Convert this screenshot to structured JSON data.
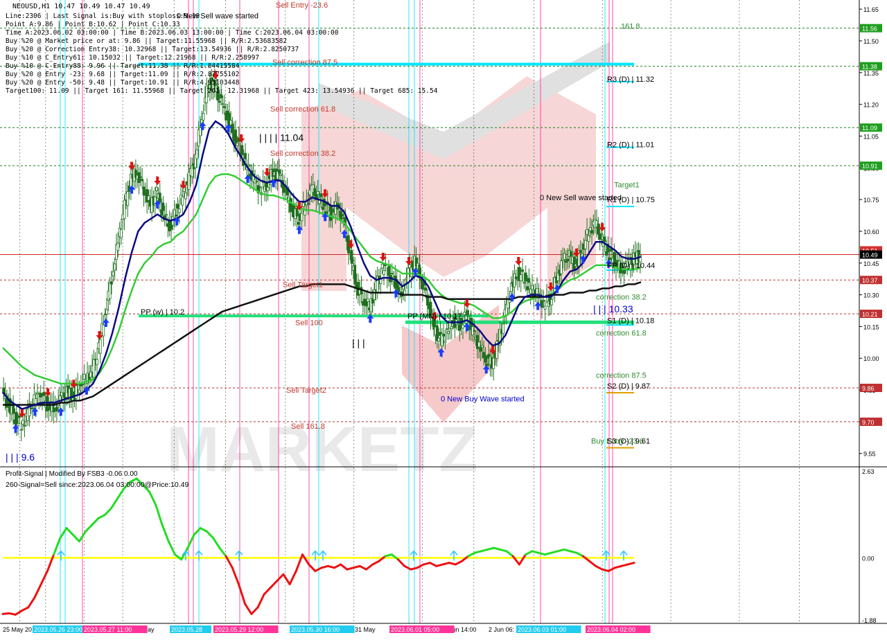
{
  "header": {
    "symbol_line": "NEOUSD,H1  10.47 10.49 10.47 10.49",
    "lines": [
      "Line:2306 | Last Signal is:Buy with stoploss:9.19",
      "Point A:9.86 | Point B:10.62 | Point C:10.33",
      "Time A:2023.06.02 03:00:00 | Time B:2023.06.03 13:00:00 | Time C:2023.06.04 03:00:00",
      "Buy %20 @ Market price or at: 9.86 || Target:11.55968 || R/R:2.53683582",
      "Buy %20 @ Correction Entry38: 10.32968 || Target:13.54936 || R/R:2.8250737",
      "Buy %10 @ C_Entry61: 10.15032 || Target:12.21968 || R/R:2.258997",
      "Buy %10 @ C_Entry88: 9.96 || Target:11.38 || R/R:1.84415584",
      "Buy %20 @ Entry -23: 9.68 || Target:11.09 || R/R:2.87755102",
      "Buy %20 @ Entry -50: 9.48 || Target:10.91 || R/R:4.93103448",
      "Target100: 11.09 || Target 161: 11.55968 || Target 261: 12.31968 || Target 423: 13.54936 || Target 685: 15.54"
    ]
  },
  "chart_data": {
    "type": "line",
    "title": "NEOUSD,H1",
    "ylim": [
      9.5,
      11.68
    ],
    "y_ticks": [
      9.55,
      9.7,
      9.85,
      10.0,
      10.15,
      10.3,
      10.45,
      10.6,
      10.75,
      10.9,
      11.05,
      11.2,
      11.35,
      11.5,
      11.65
    ],
    "x_ticks": [
      "25 May 20",
      "27 May",
      "31 May",
      "Jun 14:00",
      "2 Jun 06:",
      "06:00"
    ],
    "x_highlight_labels": [
      "2023.05.26 23:00",
      "2023.05.27 11:00",
      "2023.05.28",
      "2023.05.29 12:00",
      "2023.05.30 16:00",
      "2023.06.01 05:00",
      "2023.06.03 01:00",
      "2023.06.04 02:00"
    ],
    "price_line": 10.49,
    "price_tags": [
      {
        "value": "11.56",
        "price": 11.56,
        "color": "#1f9f1f"
      },
      {
        "value": "11.38",
        "price": 11.38,
        "color": "#1f9f1f"
      },
      {
        "value": "11.09",
        "price": 11.09,
        "color": "#1f9f1f"
      },
      {
        "value": "10.91",
        "price": 10.91,
        "color": "#1f9f1f"
      },
      {
        "value": "10.51",
        "price": 10.51,
        "color": "#d03030"
      },
      {
        "value": "10.49",
        "price": 10.49,
        "color": "#000000"
      },
      {
        "value": "10.37",
        "price": 10.37,
        "color": "#c03030"
      },
      {
        "value": "10.21",
        "price": 10.21,
        "color": "#c03030"
      },
      {
        "value": "9.86",
        "price": 9.86,
        "color": "#c03030"
      },
      {
        "value": "9.70",
        "price": 9.7,
        "color": "#c03030"
      }
    ],
    "hlines": [
      {
        "price": 11.56,
        "color": "#1f7f1f",
        "style": "dashed"
      },
      {
        "price": 11.38,
        "color": "#1f7f1f",
        "style": "dashed"
      },
      {
        "price": 11.09,
        "color": "#1f7f1f",
        "style": "dashed"
      },
      {
        "price": 10.91,
        "color": "#1f7f1f",
        "style": "dashed"
      },
      {
        "price": 10.37,
        "color": "#b03030",
        "style": "dashed"
      },
      {
        "price": 10.21,
        "color": "#b03030",
        "style": "dashed"
      },
      {
        "price": 9.86,
        "color": "#b03030",
        "style": "dashed"
      },
      {
        "price": 9.7,
        "color": "#b03030",
        "style": "dashed"
      }
    ],
    "close_series": [
      9.84,
      9.78,
      9.72,
      9.68,
      9.74,
      9.8,
      9.82,
      9.78,
      9.76,
      9.8,
      9.84,
      9.82,
      9.88,
      9.9,
      9.94,
      10.05,
      10.22,
      10.38,
      10.55,
      10.72,
      10.85,
      10.88,
      10.8,
      10.72,
      10.78,
      10.68,
      10.62,
      10.7,
      10.76,
      10.85,
      10.95,
      11.15,
      11.3,
      11.28,
      11.2,
      11.14,
      11.05,
      10.98,
      10.9,
      10.84,
      10.8,
      10.82,
      10.88,
      10.86,
      10.78,
      10.7,
      10.66,
      10.72,
      10.8,
      10.76,
      10.72,
      10.68,
      10.72,
      10.64,
      10.48,
      10.34,
      10.28,
      10.24,
      10.34,
      10.42,
      10.4,
      10.36,
      10.3,
      10.4,
      10.46,
      10.38,
      10.28,
      10.14,
      10.08,
      10.12,
      10.18,
      10.16,
      10.2,
      10.12,
      10.06,
      10.0,
      9.98,
      10.08,
      10.2,
      10.34,
      10.4,
      10.38,
      10.32,
      10.3,
      10.26,
      10.28,
      10.38,
      10.46,
      10.48,
      10.44,
      10.52,
      10.6,
      10.64,
      10.56,
      10.5,
      10.46,
      10.42,
      10.44,
      10.47,
      10.49
    ],
    "ma_slow_dark_blue": [
      9.84,
      9.8,
      9.78,
      9.76,
      9.77,
      9.78,
      9.79,
      9.79,
      9.79,
      9.8,
      9.81,
      9.82,
      9.83,
      9.85,
      9.88,
      9.94,
      10.02,
      10.12,
      10.24,
      10.38,
      10.5,
      10.6,
      10.64,
      10.66,
      10.68,
      10.66,
      10.65,
      10.66,
      10.68,
      10.74,
      10.82,
      10.96,
      11.08,
      11.12,
      11.1,
      11.06,
      11.0,
      10.95,
      10.9,
      10.86,
      10.84,
      10.83,
      10.84,
      10.84,
      10.81,
      10.77,
      10.74,
      10.74,
      10.76,
      10.75,
      10.74,
      10.72,
      10.72,
      10.69,
      10.62,
      10.53,
      10.45,
      10.39,
      10.37,
      10.38,
      10.38,
      10.37,
      10.34,
      10.36,
      10.39,
      10.38,
      10.34,
      10.27,
      10.2,
      10.17,
      10.17,
      10.17,
      10.18,
      10.16,
      10.13,
      10.09,
      10.06,
      10.07,
      10.11,
      10.18,
      10.25,
      10.29,
      10.3,
      10.3,
      10.29,
      10.29,
      10.32,
      10.37,
      10.41,
      10.42,
      10.45,
      10.5,
      10.55,
      10.55,
      10.53,
      10.51,
      10.48,
      10.47,
      10.47,
      10.48
    ],
    "ma_mid_green": [
      10.05,
      10.02,
      9.99,
      9.96,
      9.94,
      9.92,
      9.91,
      9.9,
      9.89,
      9.88,
      9.88,
      9.88,
      9.88,
      9.89,
      9.9,
      9.93,
      9.98,
      10.05,
      10.13,
      10.23,
      10.32,
      10.4,
      10.45,
      10.48,
      10.52,
      10.54,
      10.55,
      10.58,
      10.6,
      10.64,
      10.68,
      10.75,
      10.82,
      10.86,
      10.87,
      10.87,
      10.86,
      10.84,
      10.82,
      10.8,
      10.78,
      10.77,
      10.77,
      10.76,
      10.75,
      10.73,
      10.71,
      10.7,
      10.7,
      10.69,
      10.68,
      10.67,
      10.66,
      10.64,
      10.6,
      10.56,
      10.52,
      10.48,
      10.46,
      10.45,
      10.44,
      10.42,
      10.4,
      10.4,
      10.4,
      10.39,
      10.37,
      10.33,
      10.3,
      10.28,
      10.27,
      10.26,
      10.26,
      10.25,
      10.23,
      10.21,
      10.19,
      10.19,
      10.2,
      10.22,
      10.25,
      10.27,
      10.28,
      10.29,
      10.29,
      10.3,
      10.32,
      10.35,
      10.37,
      10.38,
      10.4,
      10.42,
      10.44,
      10.44,
      10.44,
      10.43,
      10.42,
      10.42,
      10.42,
      10.43
    ],
    "ma_long_black": [
      9.78,
      9.78,
      9.78,
      9.78,
      9.78,
      9.78,
      9.78,
      9.78,
      9.78,
      9.79,
      9.79,
      9.8,
      9.8,
      9.81,
      9.82,
      9.84,
      9.86,
      9.88,
      9.9,
      9.92,
      9.94,
      9.96,
      9.98,
      10.0,
      10.02,
      10.04,
      10.06,
      10.08,
      10.1,
      10.12,
      10.14,
      10.16,
      10.18,
      10.2,
      10.22,
      10.23,
      10.24,
      10.25,
      10.26,
      10.27,
      10.28,
      10.29,
      10.3,
      10.31,
      10.32,
      10.33,
      10.34,
      10.34,
      10.35,
      10.35,
      10.35,
      10.35,
      10.35,
      10.35,
      10.34,
      10.33,
      10.32,
      10.31,
      10.31,
      10.31,
      10.31,
      10.31,
      10.3,
      10.3,
      10.3,
      10.3,
      10.29,
      10.29,
      10.29,
      10.28,
      10.28,
      10.28,
      10.28,
      10.28,
      10.28,
      10.28,
      10.28,
      10.28,
      10.28,
      10.28,
      10.29,
      10.29,
      10.29,
      10.29,
      10.29,
      10.3,
      10.3,
      10.3,
      10.31,
      10.31,
      10.31,
      10.32,
      10.32,
      10.33,
      10.33,
      10.34,
      10.34,
      10.35,
      10.35,
      10.36
    ],
    "level_labels": [
      {
        "text": "Sell Entry -23.6",
        "price": 11.67,
        "color": "#c0392b"
      },
      {
        "text": "0 New Sell wave started",
        "price": 11.62,
        "color": "#000000"
      },
      {
        "text": "Sell correction 87.5",
        "price": 11.4,
        "color": "#c0392b"
      },
      {
        "text": "Sell correction 61.8",
        "price": 11.18,
        "color": "#c0392b"
      },
      {
        "text": "| | | | 11.04",
        "price": 11.04,
        "color": "#000000"
      },
      {
        "text": "Sell correction 38.2",
        "price": 10.97,
        "color": "#c0392b"
      },
      {
        "text": "Sell Target1",
        "price": 10.35,
        "color": "#c0392b"
      },
      {
        "text": "PP (w) | 10.2",
        "price": 10.22,
        "color": "#000000"
      },
      {
        "text": "Sell 100",
        "price": 10.17,
        "color": "#c0392b"
      },
      {
        "text": "| | |",
        "price": 10.07,
        "color": "#000000"
      },
      {
        "text": "PP (MN) | 10.17",
        "price": 10.2,
        "color": "#000000"
      },
      {
        "text": "Sell Target2",
        "price": 9.85,
        "color": "#c0392b"
      },
      {
        "text": "Sell 161.8",
        "price": 9.68,
        "color": "#c0392b"
      },
      {
        "text": "0 New Buy Wave started",
        "price": 9.81,
        "color": "#0000cc"
      },
      {
        "text": "| | | 9.6",
        "price": 9.53,
        "color": "#0000cc"
      },
      {
        "text": "0 New Sell wave started",
        "price": 10.76,
        "color": "#000000"
      },
      {
        "text": "161.8",
        "price": 11.57,
        "color": "#2e8b2e"
      },
      {
        "text": "R3 (D) | 11.32",
        "price": 11.32,
        "color": "#000000"
      },
      {
        "text": "R2 (D) | 11.01",
        "price": 11.01,
        "color": "#000000"
      },
      {
        "text": "Target1",
        "price": 10.82,
        "color": "#2e8b2e"
      },
      {
        "text": "R1 (D) | 10.75",
        "price": 10.75,
        "color": "#000000"
      },
      {
        "text": "PP (D) | 10.44",
        "price": 10.44,
        "color": "#000000"
      },
      {
        "text": "correction 38.2",
        "price": 10.29,
        "color": "#2e8b2e"
      },
      {
        "text": "| | | 10.33",
        "price": 10.23,
        "color": "#0000cc"
      },
      {
        "text": "S1 (D) | 10.18",
        "price": 10.18,
        "color": "#000000"
      },
      {
        "text": "correction 61.8",
        "price": 10.12,
        "color": "#2e8b2e"
      },
      {
        "text": "correction 87.5",
        "price": 9.92,
        "color": "#2e8b2e"
      },
      {
        "text": "S2 (D) | 9.87",
        "price": 9.87,
        "color": "#000000"
      },
      {
        "text": "Buy Entry -23.6",
        "price": 9.61,
        "color": "#2e8b2e"
      },
      {
        "text": "S3 (D) | 9.61",
        "price": 9.61,
        "color": "#000000"
      }
    ],
    "buy_arrows": 26,
    "sell_arrows": 22
  },
  "indicator": {
    "title": "Profit-Signal | Modified By FSB3 -0.06 0.00",
    "subtitle": "260-Signal=Sell since:2023.06.04 03:00:00@Price:10.49",
    "ylim": [
      -1.88,
      2.63
    ],
    "y_ticks": [
      "2.63",
      "0.00",
      "-1.88"
    ],
    "zero_line_color": "#ffff00",
    "values": [
      -1.7,
      -1.68,
      -1.72,
      -1.6,
      -1.5,
      -1.2,
      -0.8,
      -0.4,
      0.1,
      0.6,
      0.9,
      0.7,
      0.5,
      0.8,
      1.0,
      1.2,
      1.3,
      1.5,
      1.8,
      2.1,
      2.3,
      2.4,
      2.2,
      2.0,
      1.6,
      1.0,
      0.5,
      0.1,
      -0.05,
      0.3,
      0.7,
      0.9,
      0.8,
      0.6,
      0.3,
      0.05,
      -0.3,
      -0.8,
      -1.4,
      -1.7,
      -1.5,
      -1.1,
      -0.9,
      -0.7,
      -0.5,
      -0.8,
      -0.4,
      0.1,
      -0.2,
      -0.4,
      -0.3,
      -0.25,
      -0.3,
      -0.2,
      -0.35,
      -0.3,
      -0.25,
      -0.35,
      -0.2,
      -0.1,
      0.05,
      0.1,
      -0.05,
      -0.25,
      -0.35,
      -0.3,
      -0.2,
      -0.15,
      -0.25,
      -0.2,
      -0.15,
      -0.2,
      -0.1,
      0.05,
      0.15,
      0.2,
      0.25,
      0.3,
      0.25,
      0.2,
      0.05,
      -0.2,
      0.1,
      0.2,
      0.15,
      0.1,
      0.15,
      0.2,
      0.25,
      0.2,
      0.15,
      0.05,
      -0.1,
      -0.25,
      -0.35,
      -0.4,
      -0.3,
      -0.25,
      -0.2,
      -0.15
    ],
    "color_positive": "#22dd22",
    "color_negative": "#ee1111"
  },
  "colors": {
    "background": "#ffffff",
    "up_candle": "#1f7f1f",
    "down_candle": "#1f7f1f",
    "buy_arrow": "#1a3cff",
    "sell_arrow": "#e01010",
    "cyan_line": "#00e5ff",
    "pink_line": "#ff2d9b",
    "pp_line": "#22e07a",
    "watermark": "#f0a0a0"
  }
}
